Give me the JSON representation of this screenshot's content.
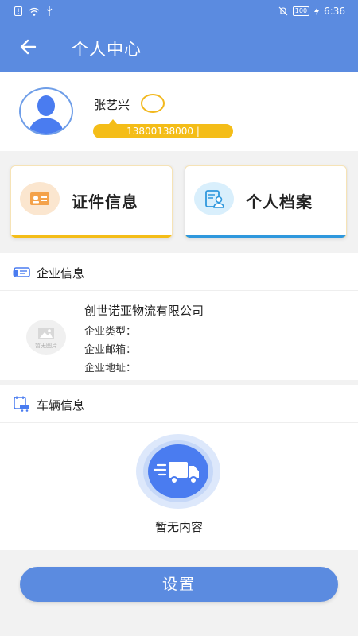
{
  "status_bar": {
    "time": "6:36",
    "battery": "100"
  },
  "app_bar": {
    "title": "个人中心"
  },
  "profile": {
    "name": "张艺兴",
    "phone": "13800138000 |"
  },
  "cards": [
    {
      "label": "证件信息",
      "icon": "id-card-icon"
    },
    {
      "label": "个人档案",
      "icon": "profile-file-icon"
    }
  ],
  "company_section": {
    "title": "企业信息",
    "no_image_text": "暂无图片",
    "company_name": "创世诺亚物流有限公司",
    "type_label": "企业类型：",
    "email_label": "企业邮箱：",
    "address_label": "企业地址："
  },
  "vehicle_section": {
    "title": "车辆信息",
    "empty_text": "暂无内容"
  },
  "settings_button": {
    "label": "设置"
  },
  "colors": {
    "primary": "#5b8be0",
    "accent_yellow": "#f4bd18",
    "accent_blue": "#2f98dd"
  }
}
